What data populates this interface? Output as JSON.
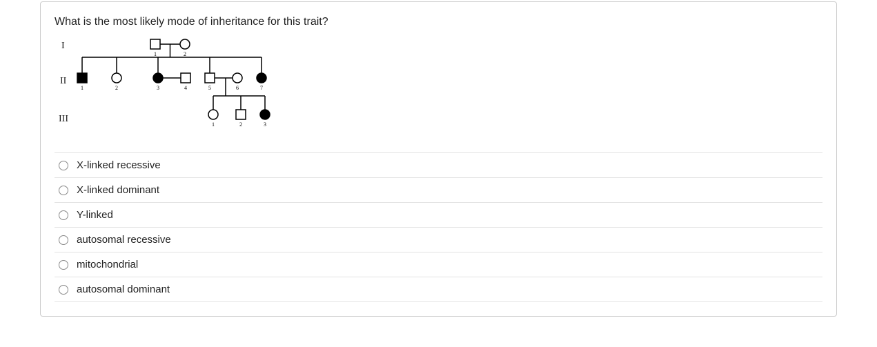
{
  "question": "What is the most likely mode of inheritance for this trait?",
  "generations": [
    "I",
    "II",
    "III"
  ],
  "pedigree": {
    "gen1": [
      {
        "n": 1,
        "sex": "M",
        "aff": false
      },
      {
        "n": 2,
        "sex": "F",
        "aff": false
      }
    ],
    "gen2": [
      {
        "n": 1,
        "sex": "M",
        "aff": true
      },
      {
        "n": 2,
        "sex": "F",
        "aff": false
      },
      {
        "n": 3,
        "sex": "F",
        "aff": true
      },
      {
        "n": 4,
        "sex": "M",
        "aff": false
      },
      {
        "n": 5,
        "sex": "M",
        "aff": false
      },
      {
        "n": 6,
        "sex": "F",
        "aff": false
      },
      {
        "n": 7,
        "sex": "F",
        "aff": true
      }
    ],
    "gen3": [
      {
        "n": 1,
        "sex": "F",
        "aff": false
      },
      {
        "n": 2,
        "sex": "M",
        "aff": false
      },
      {
        "n": 3,
        "sex": "F",
        "aff": true
      }
    ]
  },
  "options": [
    "X-linked recessive",
    "X-linked dominant",
    "Y-linked",
    "autosomal recessive",
    "mitochondrial",
    "autosomal dominant"
  ]
}
